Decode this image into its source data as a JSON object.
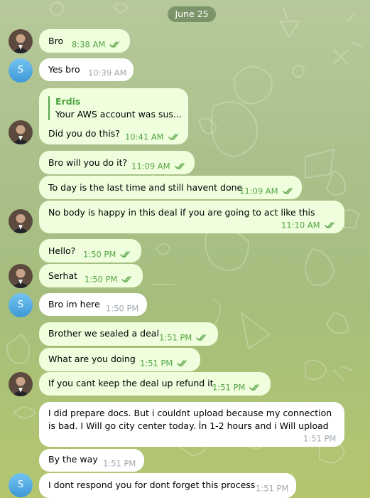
{
  "date_separator": "June 25",
  "colors": {
    "outgoing_bubble": "#effedd",
    "incoming_bubble": "#ffffff",
    "accent": "#57a546"
  },
  "contact_initial": "S",
  "messages": [
    {
      "dir": "out",
      "text": "Bro",
      "time": "8:38 AM",
      "read": true
    },
    {
      "dir": "in",
      "text": "Yes bro",
      "time": "10:39 AM"
    },
    {
      "dir": "out",
      "reply_to": {
        "name": "Erdis",
        "text": "Your AWS account was sus..."
      },
      "text": "Did you do this?",
      "time": "10:41 AM",
      "read": true
    },
    {
      "dir": "out",
      "text": "Bro will you do it?",
      "time": "11:09 AM",
      "read": true
    },
    {
      "dir": "out",
      "text": "To day is the last time and still havent done",
      "time": "11:09 AM",
      "read": true
    },
    {
      "dir": "out",
      "text": "No body is happy in this deal if you are going to act like this",
      "time": "11:10 AM",
      "read": true
    },
    {
      "dir": "out",
      "text": "Hello?",
      "time": "1:50 PM",
      "read": true
    },
    {
      "dir": "out",
      "text": "Serhat",
      "time": "1:50 PM",
      "read": true
    },
    {
      "dir": "in",
      "text": "Bro im here",
      "time": "1:50 PM"
    },
    {
      "dir": "out",
      "text": "Brother we sealed a deal",
      "time": "1:51 PM",
      "read": true
    },
    {
      "dir": "out",
      "text": "What are you doing",
      "time": "1:51 PM",
      "read": true
    },
    {
      "dir": "out",
      "text": "If you cant keep the deal up refund it",
      "time": "1:51 PM",
      "read": true
    },
    {
      "dir": "in",
      "text": "I did prepare docs. But i couldnt upload because my connection is bad. I Will go city center today. İn 1-2 hours and i Will upload",
      "time": "1:51 PM"
    },
    {
      "dir": "in",
      "text": "By the way",
      "time": "1:51 PM"
    },
    {
      "dir": "in",
      "text": "I dont respond you for dont forget this process",
      "time": "1:51 PM"
    }
  ]
}
